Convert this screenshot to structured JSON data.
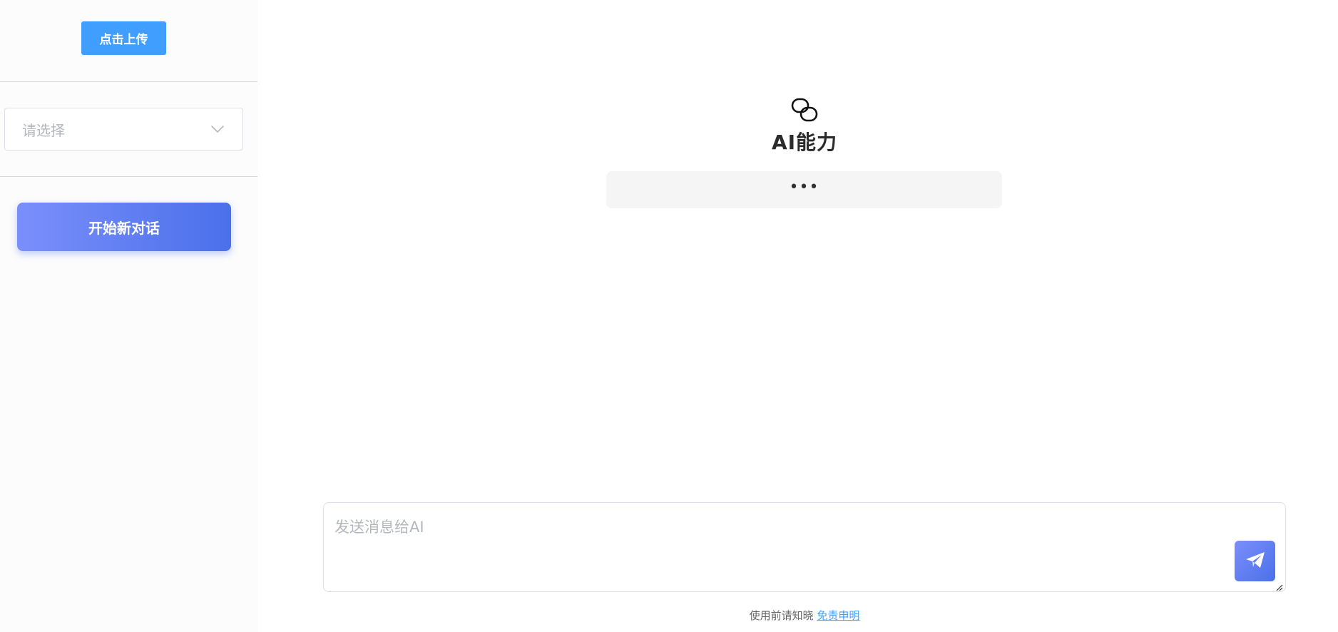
{
  "sidebar": {
    "upload_label": "点击上传",
    "select": {
      "placeholder": "请选择",
      "icon": "chevron-down-icon"
    },
    "new_chat_label": "开始新对话"
  },
  "main": {
    "logo_icon": "linked-chat-icon",
    "title": "AI能力",
    "ability_placeholder": "•••"
  },
  "composer": {
    "placeholder": "发送消息给AI",
    "value": "",
    "send_icon": "paper-plane-icon"
  },
  "footer": {
    "notice": "使用前请知晓",
    "disclaimer_link": "免责申明"
  },
  "colors": {
    "primary": "#409eff",
    "gradient_start": "#7b8ffb",
    "gradient_end": "#4a70ea"
  }
}
